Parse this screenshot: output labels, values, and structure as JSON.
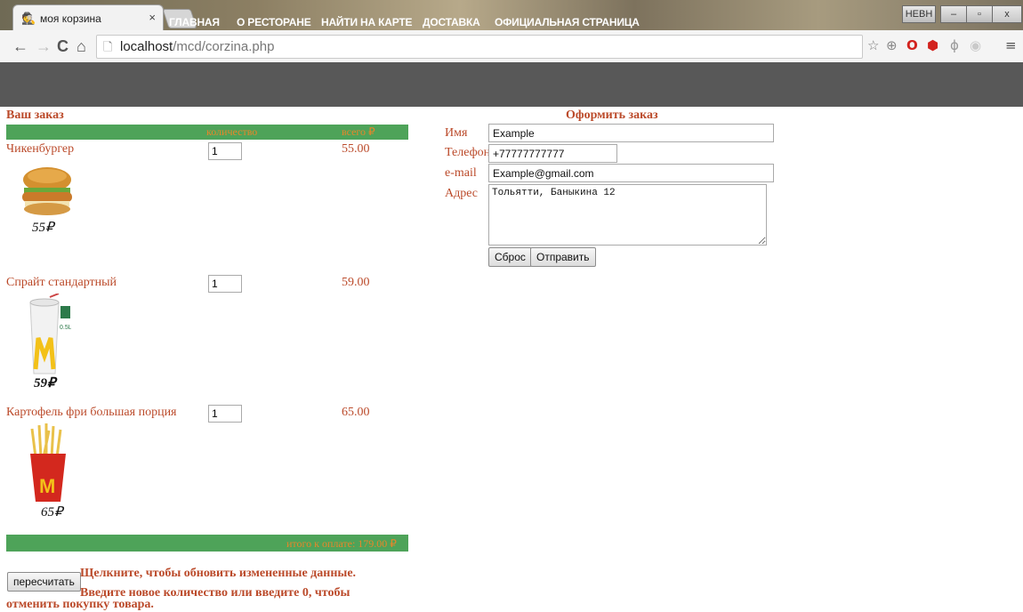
{
  "browser": {
    "tab_title": "моя корзина",
    "tab_close": "×",
    "url_host": "localhost",
    "url_path": "/mcd/corzina.php",
    "window_user_label": "НЕВН",
    "window_min": "–",
    "window_max": "▫",
    "window_close": "x"
  },
  "nav": {
    "items": [
      "ГЛАВНАЯ",
      "О РЕСТОРАНЕ",
      "НАЙТИ НА КАРТЕ",
      "ДОСТАВКА",
      "ОФИЦИАЛЬНАЯ СТРАНИЦА"
    ]
  },
  "order": {
    "title": "Ваш заказ",
    "col_qty": "количество",
    "col_price": "всего ₽",
    "items": [
      {
        "name": "Чикенбургер",
        "qty": "1",
        "price": "55.00",
        "image_label": "55₽",
        "icon": "burger-image"
      },
      {
        "name": "Спрайт стандартный",
        "qty": "1",
        "price": "59.00",
        "image_label": "59₽",
        "icon": "drink-cup-image"
      },
      {
        "name": "Картофель фри большая порция",
        "qty": "1",
        "price": "65.00",
        "image_label": "65₽",
        "icon": "fries-image"
      }
    ],
    "total_label": "итого к оплате: 179.00 ₽",
    "recalc_button": "пересчитать",
    "hint_line1": "Щелкните, чтобы обновить измененные данные.",
    "hint_line2": "Введите новое количество или введите 0, чтобы",
    "hint_line3": "отменить покупку товара."
  },
  "checkout": {
    "title": "Оформить заказ",
    "name_label": "Имя",
    "name_value": "Example",
    "phone_label": "Телефон",
    "phone_value": "+77777777777",
    "email_label": "e-mail",
    "email_value": "Example@gmail.com",
    "address_label": "Адрес",
    "address_value": "Тольятти, Баныкина 12",
    "reset_button": "Сброс",
    "submit_button": "Отправить"
  },
  "colors": {
    "nav_bg": "#585858",
    "accent_green": "#4ea359",
    "text_red": "#bb4a2a",
    "text_orange": "#e8862a"
  }
}
